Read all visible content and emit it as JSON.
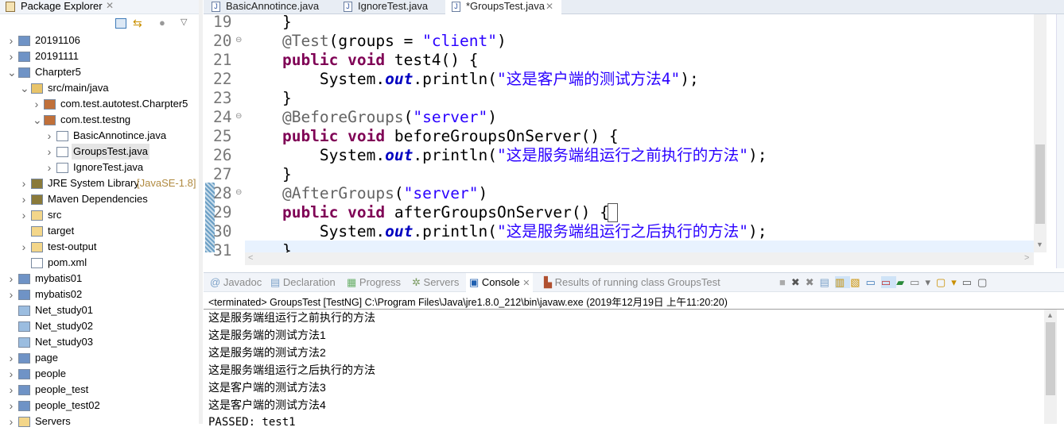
{
  "package_explorer": {
    "title": "Package Explorer",
    "items": [
      {
        "label": "20191106",
        "level": 0,
        "expand": ">",
        "icon": "java-project-icon"
      },
      {
        "label": "20191111",
        "level": 0,
        "expand": ">",
        "icon": "java-project-error-icon"
      },
      {
        "label": "Charpter5",
        "level": 0,
        "expand": "v",
        "icon": "maven-project-icon"
      },
      {
        "label": "src/main/java",
        "level": 1,
        "expand": "v",
        "icon": "source-folder-icon"
      },
      {
        "label": "com.test.autotest.Charpter5",
        "level": 2,
        "expand": ">",
        "icon": "package-icon"
      },
      {
        "label": "com.test.testng",
        "level": 2,
        "expand": "v",
        "icon": "package-icon"
      },
      {
        "label": "BasicAnnotince.java",
        "level": 3,
        "expand": ">",
        "icon": "java-file-icon"
      },
      {
        "label": "GroupsTest.java",
        "level": 3,
        "expand": ">",
        "icon": "java-file-icon",
        "selected": true
      },
      {
        "label": "IgnoreTest.java",
        "level": 3,
        "expand": ">",
        "icon": "java-file-icon"
      },
      {
        "label": "JRE System Library",
        "suffix": "[JavaSE-1.8]",
        "level": 1,
        "expand": ">",
        "icon": "library-icon"
      },
      {
        "label": "Maven Dependencies",
        "level": 1,
        "expand": ">",
        "icon": "library-icon"
      },
      {
        "label": "src",
        "level": 1,
        "expand": ">",
        "icon": "folder-icon"
      },
      {
        "label": "target",
        "level": 1,
        "expand": "",
        "icon": "folder-icon"
      },
      {
        "label": "test-output",
        "level": 1,
        "expand": ">",
        "icon": "folder-icon"
      },
      {
        "label": "pom.xml",
        "level": 1,
        "expand": "",
        "icon": "maven-file-icon"
      },
      {
        "label": "mybatis01",
        "level": 0,
        "expand": ">",
        "icon": "web-project-icon"
      },
      {
        "label": "mybatis02",
        "level": 0,
        "expand": ">",
        "icon": "web-project-icon"
      },
      {
        "label": "Net_study01",
        "level": 0,
        "expand": "",
        "icon": "closed-project-icon"
      },
      {
        "label": "Net_study02",
        "level": 0,
        "expand": "",
        "icon": "closed-project-icon"
      },
      {
        "label": "Net_study03",
        "level": 0,
        "expand": "",
        "icon": "closed-project-icon"
      },
      {
        "label": "page",
        "level": 0,
        "expand": ">",
        "icon": "web-project-icon"
      },
      {
        "label": "people",
        "level": 0,
        "expand": ">",
        "icon": "web-project-icon"
      },
      {
        "label": "people_test",
        "level": 0,
        "expand": ">",
        "icon": "web-project-warning-icon"
      },
      {
        "label": "people_test02",
        "level": 0,
        "expand": ">",
        "icon": "web-project-icon"
      },
      {
        "label": "Servers",
        "level": 0,
        "expand": ">",
        "icon": "folder-icon"
      }
    ]
  },
  "editor": {
    "tabs": [
      {
        "label": "BasicAnnotince.java",
        "active": false
      },
      {
        "label": "IgnoreTest.java",
        "active": false
      },
      {
        "label": "*GroupsTest.java",
        "active": true
      }
    ],
    "lines": [
      {
        "n": "19",
        "fold": false,
        "segs": [
          [
            "p",
            "    }"
          ]
        ]
      },
      {
        "n": "20",
        "fold": true,
        "segs": [
          [
            "a",
            "    @Test"
          ],
          [
            "p",
            "(groups = "
          ],
          [
            "s",
            "\"client\""
          ],
          [
            "p",
            ")"
          ]
        ]
      },
      {
        "n": "21",
        "fold": false,
        "segs": [
          [
            "k",
            "    public void"
          ],
          [
            "p",
            " test4() {"
          ]
        ]
      },
      {
        "n": "22",
        "fold": false,
        "segs": [
          [
            "p",
            "        System."
          ],
          [
            "f",
            "out"
          ],
          [
            "p",
            ".println("
          ],
          [
            "s",
            "\"这是客户端的测试方法4\""
          ],
          [
            "p",
            ");"
          ]
        ]
      },
      {
        "n": "23",
        "fold": false,
        "segs": [
          [
            "p",
            "    }"
          ]
        ]
      },
      {
        "n": "24",
        "fold": true,
        "segs": [
          [
            "a",
            "    @BeforeGroups"
          ],
          [
            "p",
            "("
          ],
          [
            "s",
            "\"server\""
          ],
          [
            "p",
            ")"
          ]
        ]
      },
      {
        "n": "25",
        "fold": false,
        "segs": [
          [
            "k",
            "    public void"
          ],
          [
            "p",
            " beforeGroupsOnServer() {"
          ]
        ]
      },
      {
        "n": "26",
        "fold": false,
        "segs": [
          [
            "p",
            "        System."
          ],
          [
            "f",
            "out"
          ],
          [
            "p",
            ".println("
          ],
          [
            "s",
            "\"这是服务端组运行之前执行的方法\""
          ],
          [
            "p",
            ");"
          ]
        ]
      },
      {
        "n": "27",
        "fold": false,
        "segs": [
          [
            "p",
            "    }"
          ]
        ]
      },
      {
        "n": "28",
        "fold": true,
        "segs": [
          [
            "a",
            "    @AfterGroups"
          ],
          [
            "p",
            "("
          ],
          [
            "s",
            "\"server\""
          ],
          [
            "p",
            ")"
          ]
        ]
      },
      {
        "n": "29",
        "fold": false,
        "segs": [
          [
            "k",
            "    public void"
          ],
          [
            "p",
            " afterGroupsOnServer() {"
          ]
        ]
      },
      {
        "n": "30",
        "fold": false,
        "segs": [
          [
            "p",
            "        System."
          ],
          [
            "f",
            "out"
          ],
          [
            "p",
            ".println("
          ],
          [
            "s",
            "\"这是服务端组运行之后执行的方法\""
          ],
          [
            "p",
            ");"
          ]
        ]
      },
      {
        "n": "31",
        "fold": false,
        "segs": [
          [
            "p",
            "    }"
          ]
        ]
      }
    ]
  },
  "console": {
    "tabs": [
      "Javadoc",
      "Declaration",
      "Progress",
      "Servers",
      "Console",
      "Results of running class GroupsTest"
    ],
    "active_tab": "Console",
    "status": "<terminated> GroupsTest [TestNG] C:\\Program Files\\Java\\jre1.8.0_212\\bin\\javaw.exe (2019年12月19日 上午11:20:20)",
    "output": [
      "这是服务端组运行之前执行的方法",
      "这是服务端的测试方法1",
      "这是服务端的测试方法2",
      "这是服务端组运行之后执行的方法",
      "这是客户端的测试方法3",
      "这是客户端的测试方法4",
      "PASSED: test1"
    ]
  },
  "colors": {
    "keyword": "#7f0055",
    "string": "#2a00ff",
    "annotation": "#646464",
    "field": "#0000c0",
    "current_line": "#e8f2fe"
  }
}
